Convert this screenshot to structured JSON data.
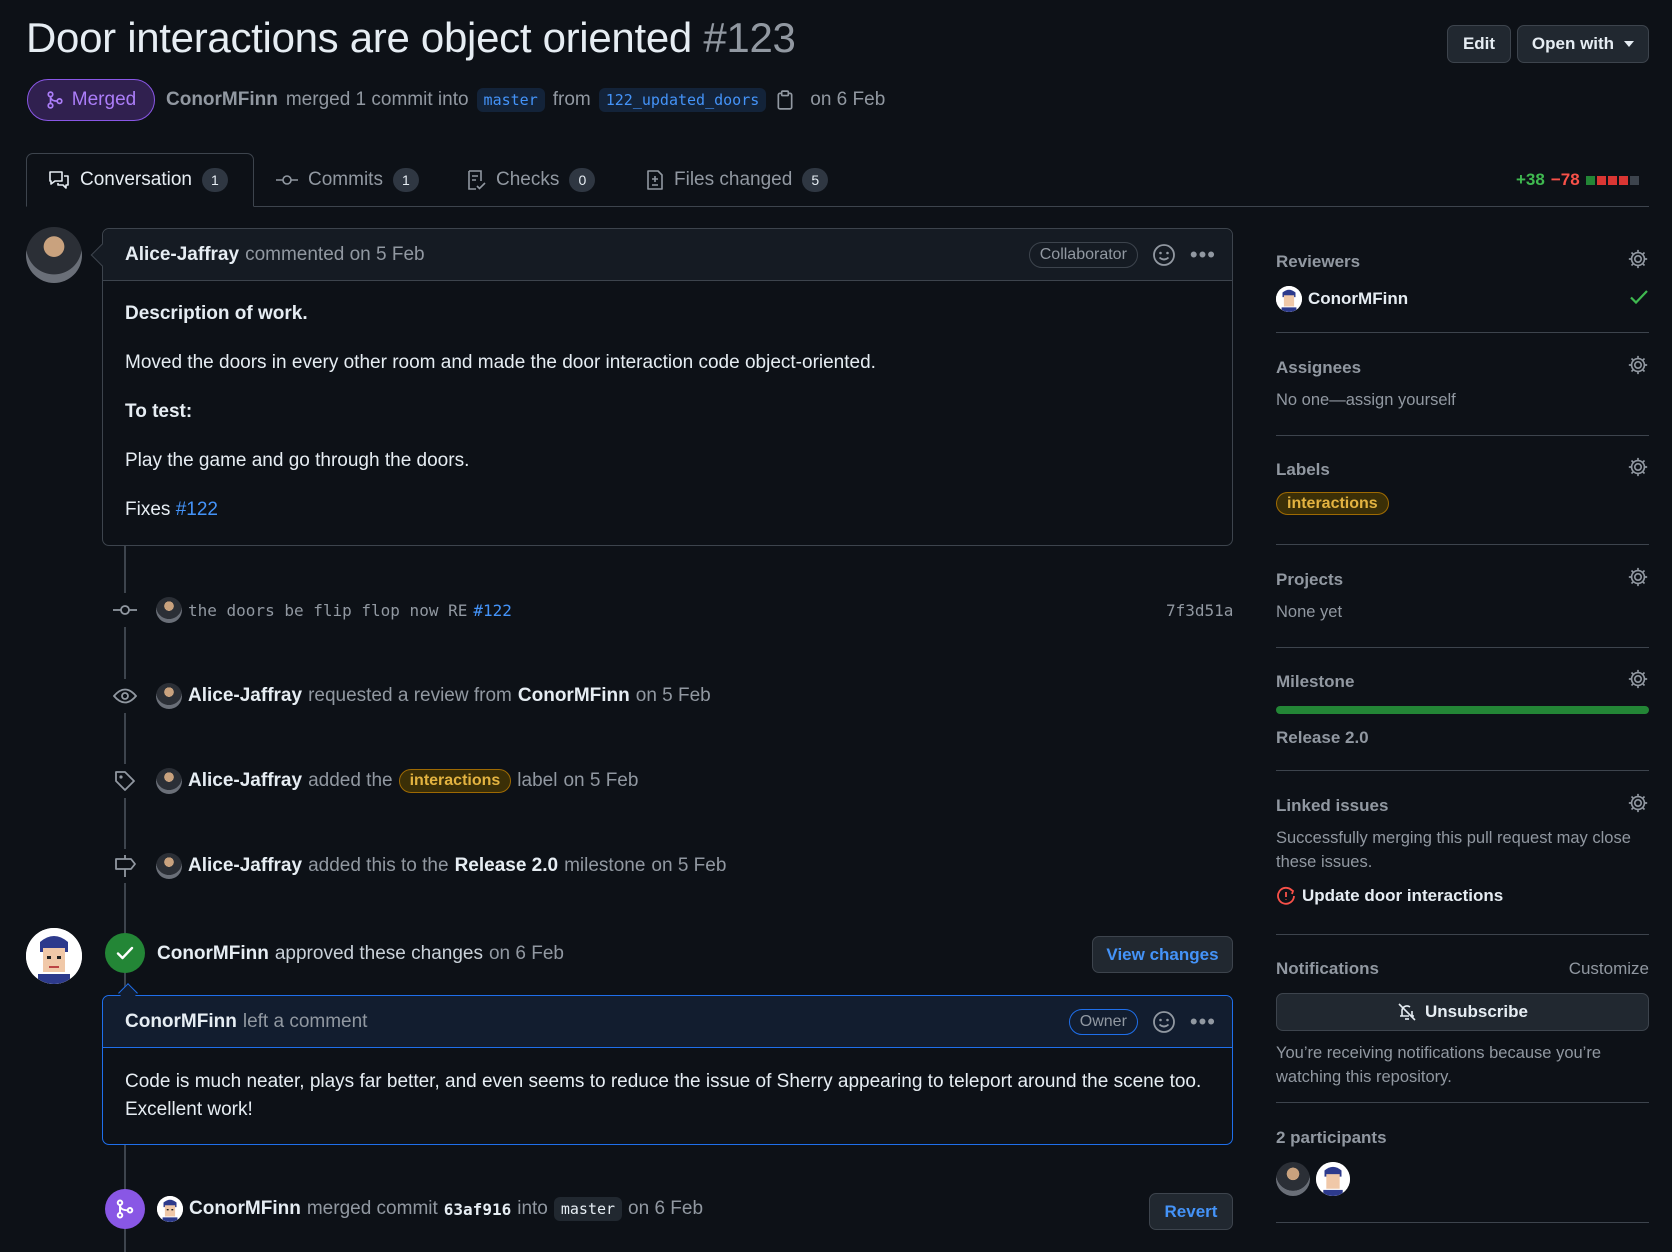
{
  "header": {
    "title": "Door interactions are object oriented",
    "number": "#123",
    "edit_label": "Edit",
    "open_with_label": "Open with",
    "status": "Merged",
    "author": "ConorMFinn",
    "merge_text": "merged 1 commit into",
    "base_branch": "master",
    "from_text": "from",
    "head_branch": "122_updated_doors",
    "date_text": "on 6 Feb"
  },
  "tabs": [
    {
      "label": "Conversation",
      "count": "1",
      "icon": "comment-discussion-icon"
    },
    {
      "label": "Commits",
      "count": "1",
      "icon": "commit-icon"
    },
    {
      "label": "Checks",
      "count": "0",
      "icon": "checklist-icon"
    },
    {
      "label": "Files changed",
      "count": "5",
      "icon": "file-diff-icon"
    }
  ],
  "diffstat": {
    "additions": "+38",
    "deletions": "−78"
  },
  "first_comment": {
    "author": "Alice-Jaffray",
    "action": "commented on 5 Feb",
    "role": "Collaborator",
    "heading1": "Description of work.",
    "para1": "Moved the doors in every other room and made the door interaction code object-oriented.",
    "heading2": "To test:",
    "para2": "Play the game and go through the doors.",
    "fixes_text": "Fixes",
    "fixes_link": "#122"
  },
  "events": {
    "commit": {
      "message": "the doors be flip flop now RE",
      "ref": "#122",
      "sha": "7f3d51a"
    },
    "review_request": {
      "actor": "Alice-Jaffray",
      "text": "requested a review from",
      "target": "ConorMFinn",
      "date": "on 5 Feb"
    },
    "label_added": {
      "actor": "Alice-Jaffray",
      "text": "added the",
      "label": "interactions",
      "suffix": "label",
      "date": "on 5 Feb"
    },
    "milestone_added": {
      "actor": "Alice-Jaffray",
      "text": "added this to the",
      "milestone": "Release 2.0",
      "suffix": "milestone",
      "date": "on 5 Feb"
    },
    "approval": {
      "actor": "ConorMFinn",
      "text": "approved these changes",
      "date": "on 6 Feb",
      "button": "View changes"
    },
    "merge": {
      "actor": "ConorMFinn",
      "text": "merged commit",
      "sha": "63af916",
      "into": "into",
      "branch": "master",
      "date": "on 6 Feb",
      "button": "Revert"
    }
  },
  "review_comment": {
    "author": "ConorMFinn",
    "action": "left a comment",
    "role": "Owner",
    "body": "Code is much neater, plays far better, and even seems to reduce the issue of Sherry appearing to teleport around the scene too. Excellent work!"
  },
  "sidebar": {
    "reviewers": {
      "title": "Reviewers",
      "name": "ConorMFinn"
    },
    "assignees": {
      "title": "Assignees",
      "text": "No one—assign yourself"
    },
    "labels": {
      "title": "Labels",
      "label": "interactions"
    },
    "projects": {
      "title": "Projects",
      "text": "None yet"
    },
    "milestone": {
      "title": "Milestone",
      "name": "Release 2.0",
      "progress": 1.0
    },
    "linked_issues": {
      "title": "Linked issues",
      "text": "Successfully merging this pull request may close these issues.",
      "issue": "Update door interactions"
    },
    "notifications": {
      "title": "Notifications",
      "customize": "Customize",
      "button": "Unsubscribe",
      "text": "You’re receiving notifications because you’re watching this repository."
    },
    "participants": {
      "title": "2 participants"
    }
  },
  "colors": {
    "background": "#0d1117",
    "merged_purple": "#8957e5",
    "success_green": "#238636",
    "link_blue": "#4493f8",
    "label_yellow": "#e3b341"
  }
}
